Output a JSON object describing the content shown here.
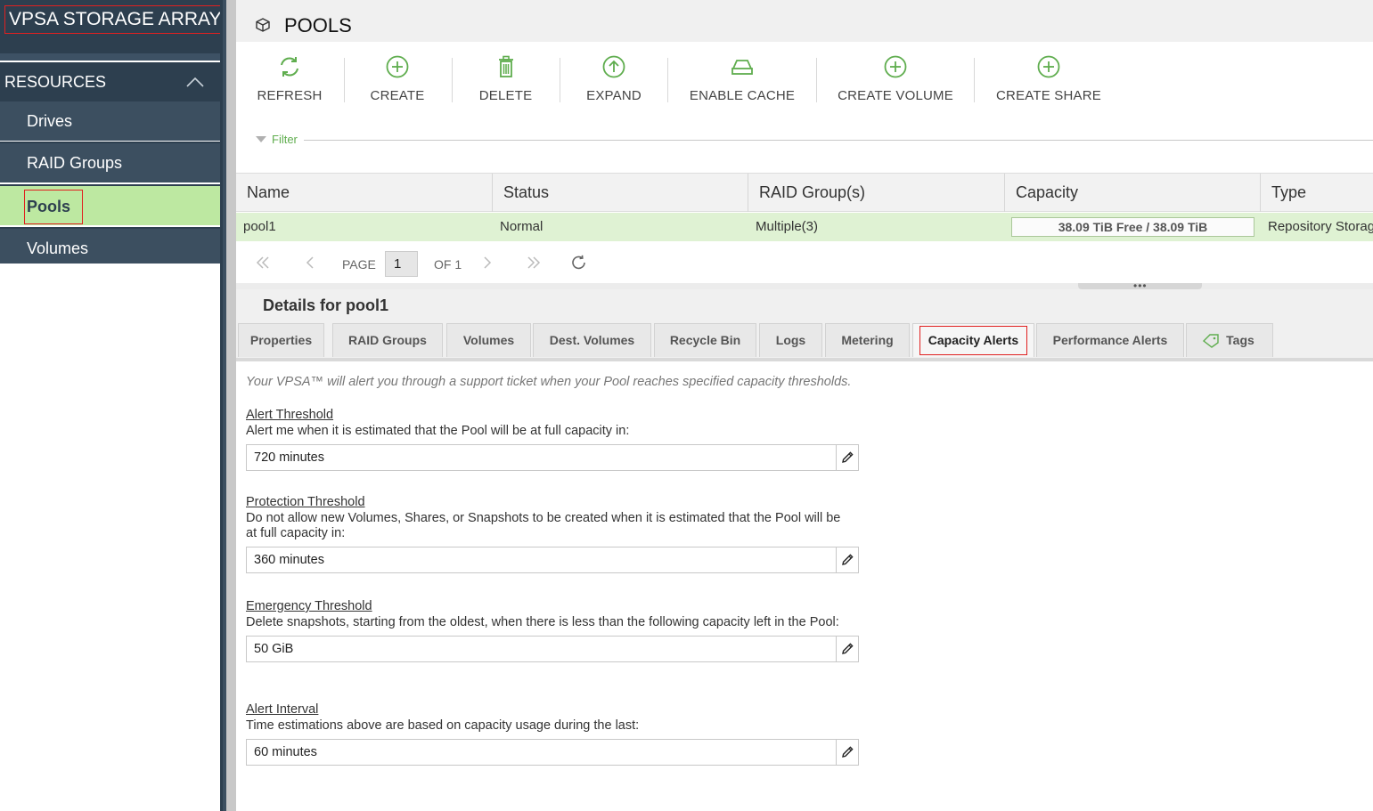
{
  "app": {
    "title": "VPSA STORAGE ARRAY"
  },
  "sidebar": {
    "section_label": "RESOURCES",
    "items": [
      {
        "label": "Drives"
      },
      {
        "label": "RAID Groups"
      },
      {
        "label": "Pools"
      },
      {
        "label": "Volumes"
      }
    ],
    "active_item": "Pools"
  },
  "header": {
    "title": "POOLS",
    "icon": "cube-icon"
  },
  "toolbar": {
    "refresh": "REFRESH",
    "create": "CREATE",
    "delete": "DELETE",
    "expand": "EXPAND",
    "enable_cache": "ENABLE CACHE",
    "create_volume": "CREATE VOLUME",
    "create_share": "CREATE SHARE"
  },
  "filter": {
    "label": "Filter"
  },
  "table": {
    "columns": [
      "Name",
      "Status",
      "RAID Group(s)",
      "Capacity",
      "Type"
    ],
    "rows": [
      {
        "name": "pool1",
        "status": "Normal",
        "raid_groups": "Multiple(3)",
        "capacity": "38.09 TiB Free / 38.09 TiB",
        "type": "Repository Storag"
      }
    ]
  },
  "pager": {
    "page_label": "PAGE",
    "page_value": "1",
    "of_label": "OF 1"
  },
  "details": {
    "title": "Details for pool1",
    "tabs": [
      "Properties",
      "RAID Groups",
      "Volumes",
      "Dest. Volumes",
      "Recycle Bin",
      "Logs",
      "Metering",
      "Capacity Alerts",
      "Performance Alerts",
      "Tags"
    ],
    "active_tab": "Capacity Alerts"
  },
  "capacity_alerts": {
    "intro": "Your VPSA™ will alert you through a support ticket when your Pool reaches specified capacity thresholds.",
    "alert_threshold": {
      "title": "Alert Threshold",
      "desc": "Alert me when it is estimated that the Pool will be at full capacity in:",
      "value": "720 minutes"
    },
    "protection_threshold": {
      "title": "Protection Threshold",
      "desc": "Do not allow new Volumes, Shares, or Snapshots to be created when it is estimated that the Pool will be at full capacity in:",
      "value": "360 minutes"
    },
    "emergency_threshold": {
      "title": "Emergency Threshold",
      "desc": "Delete snapshots, starting from the oldest, when there is less than the following capacity left in the Pool:",
      "value": "50 GiB"
    },
    "alert_interval": {
      "title": "Alert Interval",
      "desc": "Time estimations above are based on capacity usage during the last:",
      "value": "60 minutes"
    }
  },
  "colors": {
    "sidebar_dark": "#2d3f4f",
    "sidebar_item": "#3c4f60",
    "active_green": "#bde8a1",
    "row_highlight": "#dff2d3",
    "icon_green": "#5fad4e",
    "highlight_border": "#e02020"
  }
}
